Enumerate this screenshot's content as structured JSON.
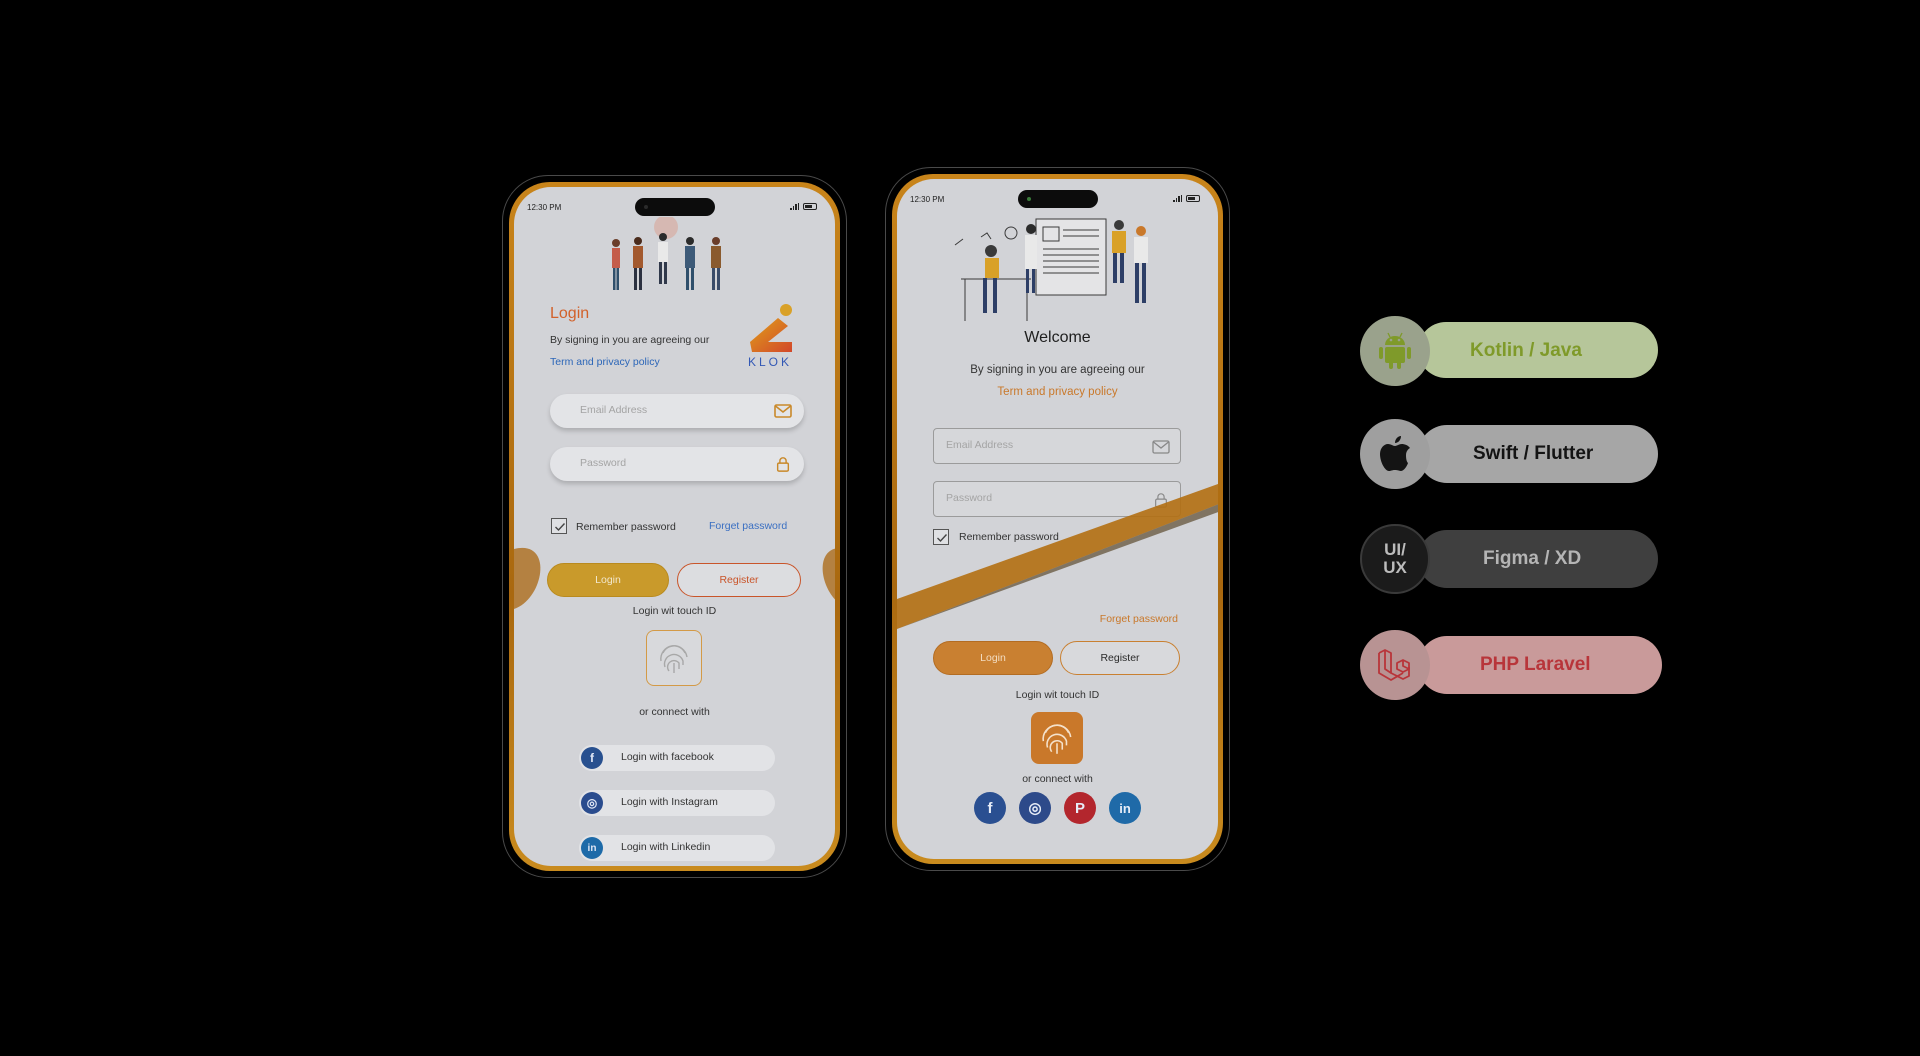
{
  "phone_a": {
    "status_time": "12:30 PM",
    "title": "Login",
    "agree_text": "By signing in you are agreeing our",
    "agree_link": "Term and privacy policy",
    "brand": "KLOK",
    "email_placeholder": "Email Address",
    "password_placeholder": "Password",
    "remember": "Remember password",
    "forget": "Forget password",
    "login_button": "Login",
    "register_button": "Register",
    "touch_id": "Login wit touch ID",
    "connect": "or connect with",
    "socials": [
      {
        "label": "Login with facebook",
        "icon": "facebook-icon",
        "glyph": "f"
      },
      {
        "label": "Login with Instagram",
        "icon": "instagram-icon",
        "glyph": "◎"
      },
      {
        "label": "Login with Linkedin",
        "icon": "linkedin-icon",
        "glyph": "in"
      }
    ]
  },
  "phone_b": {
    "status_time": "12:30 PM",
    "title": "Welcome",
    "agree_text": "By signing in you are agreeing our",
    "agree_link": "Term and privacy policy",
    "email_placeholder": "Email Address",
    "password_placeholder": "Password",
    "remember": "Remember password",
    "forget": "Forget password",
    "login_button": "Login",
    "register_button": "Register",
    "touch_id": "Login wit touch ID",
    "connect": "or connect with",
    "social_glyphs": {
      "facebook": "f",
      "instagram": "◎",
      "pinterest": "P",
      "linkedin": "in"
    }
  },
  "tech_stack": [
    {
      "label": "Kotlin / Java",
      "icon": "android-icon",
      "color": "#7f9a2a"
    },
    {
      "label": "Swift / Flutter",
      "icon": "apple-icon",
      "color": "#141414"
    },
    {
      "label": "Figma / XD",
      "icon": "ui-ux-icon",
      "icon_text_top": "UI/",
      "icon_text_bottom": "UX",
      "color": "#b5b5b5"
    },
    {
      "label": "PHP Laravel",
      "icon": "laravel-icon",
      "color": "#b8353a"
    }
  ],
  "colors": {
    "accent_orange": "#c9782a",
    "gold": "#c99a2b",
    "link_blue": "#2c66b8",
    "background": "#000000"
  }
}
